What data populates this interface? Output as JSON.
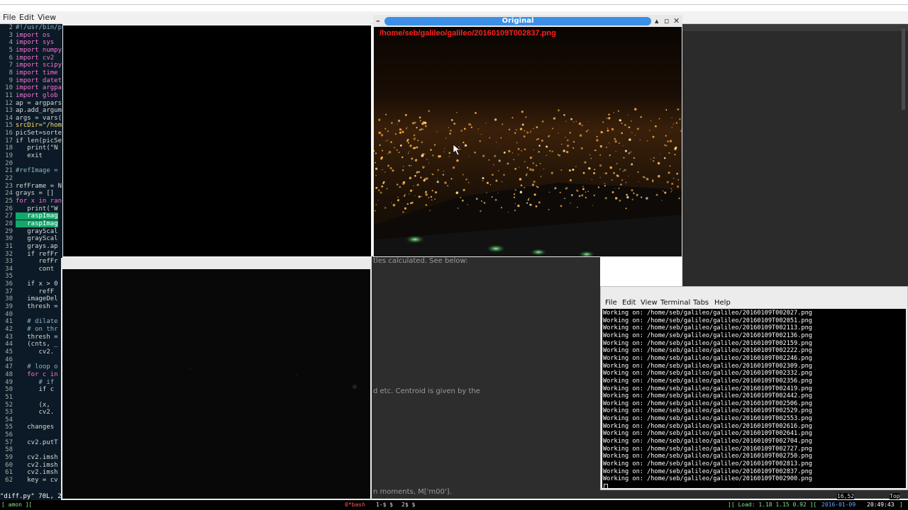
{
  "gvim_menu": [
    "File",
    "Edit",
    "View"
  ],
  "editor_lines": [
    {
      "n": "2",
      "t": "#!/usr/bin/p",
      "c": "cm"
    },
    {
      "n": "3",
      "t": "import os",
      "c": "kw"
    },
    {
      "n": "4",
      "t": "import sys",
      "c": "kw"
    },
    {
      "n": "5",
      "t": "import numpy",
      "c": "kw"
    },
    {
      "n": "6",
      "t": "import cv2",
      "c": "kw"
    },
    {
      "n": "7",
      "t": "import scipy",
      "c": "kw"
    },
    {
      "n": "8",
      "t": "import time",
      "c": "kw"
    },
    {
      "n": "9",
      "t": "import datet",
      "c": "kw"
    },
    {
      "n": "10",
      "t": "import argpa",
      "c": "kw"
    },
    {
      "n": "11",
      "t": "import glob",
      "c": "kw"
    },
    {
      "n": "12",
      "t": "ap = argpars",
      "c": ""
    },
    {
      "n": "13",
      "t": "ap.add_argum",
      "c": ""
    },
    {
      "n": "14",
      "t": "args = vars(",
      "c": ""
    },
    {
      "n": "15",
      "t": "srcDir=\"/hom",
      "c": "str"
    },
    {
      "n": "16",
      "t": "picSet=sorte",
      "c": ""
    },
    {
      "n": "17",
      "t": "if len(picSe",
      "c": ""
    },
    {
      "n": "18",
      "t": "   print(\"N",
      "c": ""
    },
    {
      "n": "19",
      "t": "   exit",
      "c": ""
    },
    {
      "n": "20",
      "t": "",
      "c": ""
    },
    {
      "n": "21",
      "t": "#refImage =",
      "c": "cm"
    },
    {
      "n": "22",
      "t": "",
      "c": ""
    },
    {
      "n": "23",
      "t": "refFrame = N",
      "c": ""
    },
    {
      "n": "24",
      "t": "grays = []",
      "c": ""
    },
    {
      "n": "25",
      "t": "for x in ran",
      "c": "kw"
    },
    {
      "n": "26",
      "t": "   print(\"W",
      "c": ""
    },
    {
      "n": "27",
      "t": "   raspImag",
      "c": "hl"
    },
    {
      "n": "28",
      "t": "   raspImag",
      "c": "hl"
    },
    {
      "n": "29",
      "t": "   grayScal",
      "c": ""
    },
    {
      "n": "30",
      "t": "   grayScal",
      "c": ""
    },
    {
      "n": "31",
      "t": "   grays.ap",
      "c": ""
    },
    {
      "n": "32",
      "t": "   if refFr",
      "c": ""
    },
    {
      "n": "33",
      "t": "      refFr",
      "c": ""
    },
    {
      "n": "34",
      "t": "      cont",
      "c": ""
    },
    {
      "n": "35",
      "t": "",
      "c": ""
    },
    {
      "n": "36",
      "t": "   if x > 0",
      "c": ""
    },
    {
      "n": "37",
      "t": "      refF",
      "c": ""
    },
    {
      "n": "38",
      "t": "   imageDel",
      "c": ""
    },
    {
      "n": "39",
      "t": "   thresh =",
      "c": ""
    },
    {
      "n": "40",
      "t": "",
      "c": ""
    },
    {
      "n": "41",
      "t": "   # dilate",
      "c": "cm"
    },
    {
      "n": "42",
      "t": "   # on thr",
      "c": "cm"
    },
    {
      "n": "43",
      "t": "   thresh =",
      "c": ""
    },
    {
      "n": "44",
      "t": "   (cnts, _",
      "c": ""
    },
    {
      "n": "45",
      "t": "      cv2.",
      "c": ""
    },
    {
      "n": "46",
      "t": "",
      "c": ""
    },
    {
      "n": "47",
      "t": "   # loop o",
      "c": "cm"
    },
    {
      "n": "48",
      "t": "   for c in",
      "c": "kw"
    },
    {
      "n": "49",
      "t": "      # if",
      "c": "cm"
    },
    {
      "n": "50",
      "t": "      if c",
      "c": ""
    },
    {
      "n": "51",
      "t": "",
      "c": ""
    },
    {
      "n": "52",
      "t": "      (x,",
      "c": ""
    },
    {
      "n": "53",
      "t": "      cv2.",
      "c": ""
    },
    {
      "n": "54",
      "t": "",
      "c": ""
    },
    {
      "n": "55",
      "t": "   changes",
      "c": ""
    },
    {
      "n": "56",
      "t": "",
      "c": ""
    },
    {
      "n": "57",
      "t": "   cv2.putT",
      "c": ""
    },
    {
      "n": "58",
      "t": "",
      "c": ""
    },
    {
      "n": "59",
      "t": "   cv2.imsh",
      "c": ""
    },
    {
      "n": "60",
      "t": "   cv2.imsh",
      "c": ""
    },
    {
      "n": "61",
      "t": "   cv2.imsh",
      "c": ""
    },
    {
      "n": "62",
      "t": "   key = cv",
      "c": ""
    }
  ],
  "vim_status": "\"diff.py\" 70L, 2",
  "vim_pos": "16,52",
  "vim_top": "Top",
  "original_window": {
    "title": "Original",
    "path": "/home/seb/galileo/galileo/20160109T002837.png"
  },
  "bg_text": {
    "t1": "tles calculated. See below:",
    "t2": "d etc. Centroid is given by the",
    "t3": "n moments, M['m00']."
  },
  "terminal": {
    "menu": [
      "File",
      "Edit",
      "View",
      "Terminal",
      "Tabs",
      "Help"
    ],
    "lines": [
      "Working on: /home/seb/galileo/galileo/20160109T002027.png",
      "Working on: /home/seb/galileo/galileo/20160109T002051.png",
      "Working on: /home/seb/galileo/galileo/20160109T002113.png",
      "Working on: /home/seb/galileo/galileo/20160109T002136.png",
      "Working on: /home/seb/galileo/galileo/20160109T002159.png",
      "Working on: /home/seb/galileo/galileo/20160109T002222.png",
      "Working on: /home/seb/galileo/galileo/20160109T002246.png",
      "Working on: /home/seb/galileo/galileo/20160109T002309.png",
      "Working on: /home/seb/galileo/galileo/20160109T002332.png",
      "Working on: /home/seb/galileo/galileo/20160109T002356.png",
      "Working on: /home/seb/galileo/galileo/20160109T002419.png",
      "Working on: /home/seb/galileo/galileo/20160109T002442.png",
      "Working on: /home/seb/galileo/galileo/20160109T002506.png",
      "Working on: /home/seb/galileo/galileo/20160109T002529.png",
      "Working on: /home/seb/galileo/galileo/20160109T002553.png",
      "Working on: /home/seb/galileo/galileo/20160109T002616.png",
      "Working on: /home/seb/galileo/galileo/20160109T002641.png",
      "Working on: /home/seb/galileo/galileo/20160109T002704.png",
      "Working on: /home/seb/galileo/galileo/20160109T002727.png",
      "Working on: /home/seb/galileo/galileo/20160109T002750.png",
      "Working on: /home/seb/galileo/galileo/20160109T002813.png",
      "Working on: /home/seb/galileo/galileo/20160109T002837.png",
      "Working on: /home/seb/galileo/galileo/20160109T002900.png"
    ]
  },
  "statusbar": {
    "left": "[ amon ][",
    "bash": "0*bash",
    "win1": "1-$ $",
    "win2": "2$ $",
    "load": "][ Load: 1.18 1.15 0.92 ][",
    "date": "2016-01-09",
    "time": "20:49:43",
    "end": "]"
  }
}
